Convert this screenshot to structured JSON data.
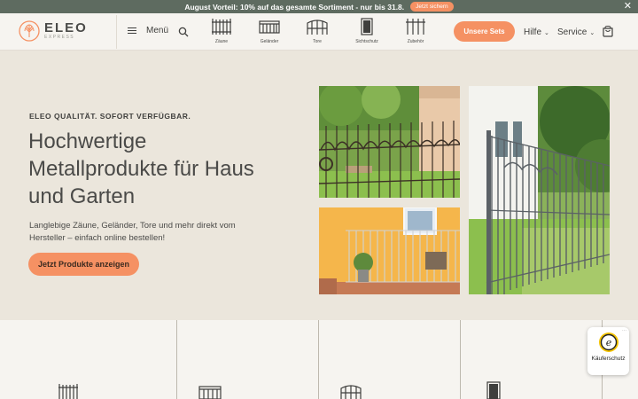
{
  "promo": {
    "text": "August Vorteil: 10% auf das gesamte Sortiment - nur bis 31.8.",
    "cta": "Jetzt sichern",
    "close_icon": "close-icon"
  },
  "header": {
    "logo": {
      "name": "ELEO",
      "sub": "EXPRESS",
      "icon": "tree-logo-icon"
    },
    "menu_label": "Menü",
    "search_icon": "search-icon",
    "categories": [
      {
        "label": "Zäune",
        "icon": "fence-icon"
      },
      {
        "label": "Geländer",
        "icon": "railing-icon"
      },
      {
        "label": "Tore",
        "icon": "gate-icon"
      },
      {
        "label": "Sichtschutz",
        "icon": "privacy-screen-icon"
      },
      {
        "label": "Zubehör",
        "icon": "accessories-icon"
      }
    ],
    "sets_button": "Unsere Sets",
    "nav": [
      {
        "label": "Hilfe"
      },
      {
        "label": "Service"
      }
    ],
    "cart_icon": "cart-icon"
  },
  "hero": {
    "eyebrow": "ELEO QUALITÄT. SOFORT VERFÜGBAR.",
    "headline": "Hochwertige Metallprodukte für Haus und Garten",
    "subtext": "Langlebige Zäune, Geländer, Tore und mehr direkt vom Hersteller – einfach online bestellen!",
    "button": "Jetzt Produkte anzeigen"
  },
  "trust_badge": {
    "label": "Käuferschutz",
    "icon": "trusted-shops-seal-icon"
  },
  "colors": {
    "accent": "#f59163",
    "promo_bg": "#5e6b60",
    "hero_bg": "#ebe6dc",
    "header_bg": "#f6f4f0",
    "text": "#4a4a48"
  }
}
